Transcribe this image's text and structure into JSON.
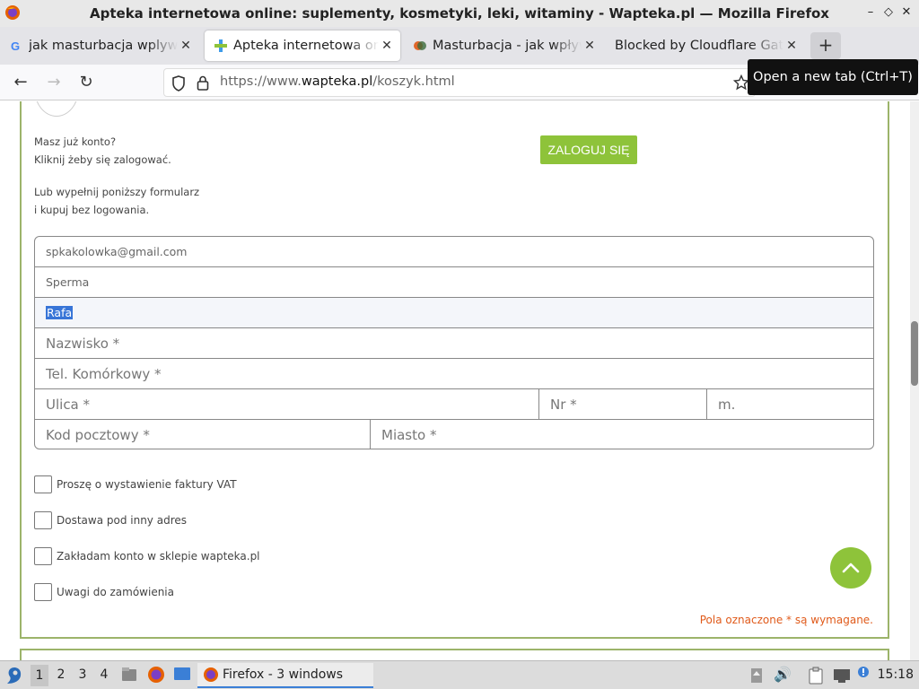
{
  "window": {
    "title": "Apteka internetowa online: suplementy, kosmetyki, leki, witaminy - Wapteka.pl — Mozilla Firefox",
    "controls": [
      "–",
      "◇",
      "✕"
    ]
  },
  "tabs": [
    {
      "label": "jak masturbacja wplywa",
      "favicon": "google-icon"
    },
    {
      "label": "Apteka internetowa online",
      "favicon": "wapteka-icon",
      "active": true
    },
    {
      "label": "Masturbacja - jak wpływa",
      "favicon": "site-icon"
    },
    {
      "label": "Blocked by Cloudflare Gateway",
      "favicon": "none"
    }
  ],
  "tooltip": "Open a new tab (Ctrl+T)",
  "navbar": {
    "url_prefix": "https://www.",
    "url_domain": "wapteka.pl",
    "url_path": "/koszyk.html"
  },
  "page": {
    "login_prompt_1": "Masz już konto?",
    "login_prompt_2": "Kliknij żeby się zalogować.",
    "login_button": "ZALOGUJ SIĘ",
    "guest_prompt_1": "Lub wypełnij poniższy formularz",
    "guest_prompt_2": "i kupuj bez logowania.",
    "form": {
      "email": "spkakolowka@gmail.com",
      "password": "Sperma",
      "first_name": "Rafa",
      "last_name_placeholder": "Nazwisko *",
      "phone_placeholder": "Tel. Komórkowy *",
      "street_placeholder": "Ulica *",
      "number_placeholder": "Nr *",
      "flat_placeholder": "m.",
      "postcode_placeholder": "Kod pocztowy *",
      "city_placeholder": "Miasto *"
    },
    "checkboxes": [
      "Proszę o wystawienie faktury VAT",
      "Dostawa pod inny adres",
      "Zakładam konto w sklepie wapteka.pl",
      "Uwagi do zamówienia"
    ],
    "required_note": "Pola oznaczone * są wymagane."
  },
  "taskbar": {
    "workspaces": [
      "1",
      "2",
      "3",
      "4"
    ],
    "task_label": "Firefox - 3 windows",
    "clock": "15:18"
  },
  "colors": {
    "accent_green": "#8ec33a",
    "panel_border": "#9cb46a",
    "required_text": "#e05a1a",
    "selection": "#3875d7"
  }
}
